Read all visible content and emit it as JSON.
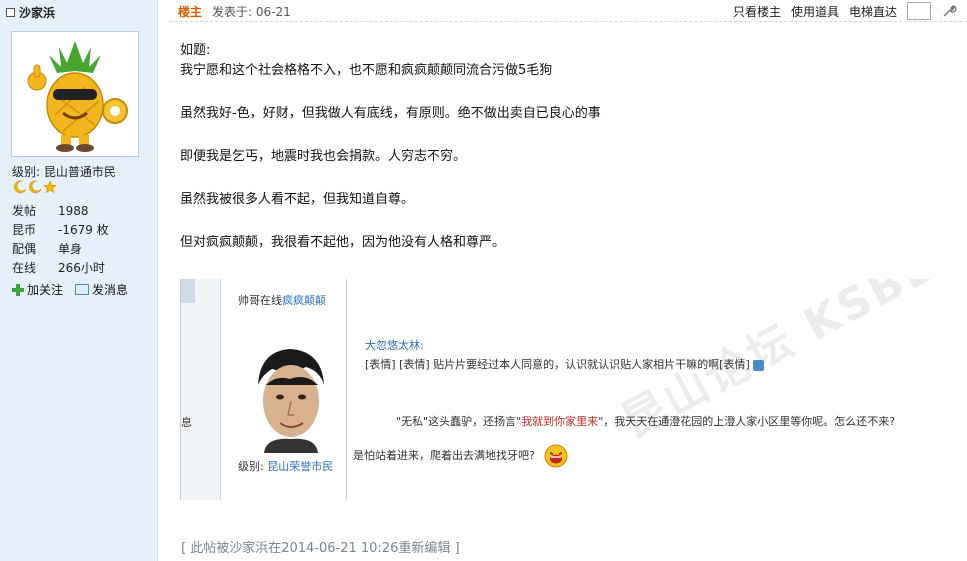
{
  "user": {
    "name": "沙家浜",
    "level_label": "级别: 昆山普通市民",
    "stats": [
      {
        "label": "发帖",
        "value": "1988"
      },
      {
        "label": "昆币",
        "value": "-1679 枚"
      },
      {
        "label": "配偶",
        "value": "单身"
      },
      {
        "label": "在线",
        "value": "266小时"
      }
    ],
    "actions": {
      "follow": "加关注",
      "message": "发消息"
    }
  },
  "post_header": {
    "owner_tag": "楼主",
    "posted_at": "发表于: 06-21",
    "only_owner": "只看楼主",
    "use_tools": "使用道具",
    "elevator": "电梯直达"
  },
  "post_body": [
    "如题:",
    "我宁愿和这个社会格格不入，也不愿和疯疯颠颠同流合污做5毛狗",
    "虽然我好-色，好财，但我做人有底线，有原则。绝不做出卖自已良心的事",
    "即便我是乞丐，地震时我也会捐款。人穷志不穷。",
    "虽然我被很多人看不起，但我知道自尊。",
    "但对疯疯颠颠，我很看不起他，因为他没有人格和尊严。"
  ],
  "embed": {
    "side_text": "息",
    "online_prefix": "帅哥在线",
    "online_name": "疯疯颠颠",
    "level_prefix": "级别: ",
    "level_value": "昆山荣誉市民",
    "reply_to": "大忽悠太林:",
    "quote": "[表情] [表情] 贴片片要经过本人同意的，认识就认识贴人家相片干嘛的啊[表情]",
    "line1_a": "\"无私\"这头蠢驴，还扬言\"",
    "line1_red": "我就到你家里来",
    "line1_b": "\"，我天天在通澄花园的上澄人家小区里等你呢。怎么还不来?",
    "line2": "是怕站着进来，爬着出去满地找牙吧?",
    "watermark": "昆山论坛 KSBBS"
  },
  "edit_note": "[ 此帖被沙家浜在2014-06-21 10:26重新编辑 ]",
  "colors": {
    "sidebar_bg": "#e6f0fa",
    "owner_tag": "#e05a00",
    "link_blue": "#2a6fb8",
    "red_text": "#c62b2b"
  }
}
